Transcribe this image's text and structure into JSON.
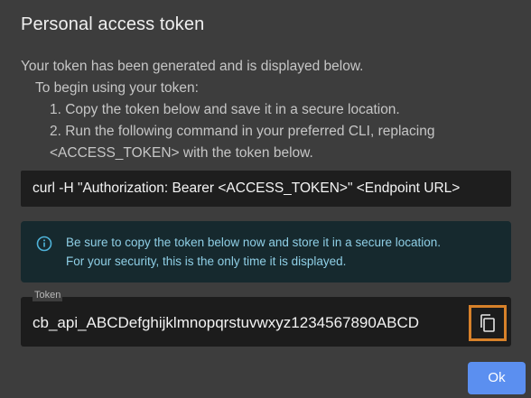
{
  "dialog": {
    "title": "Personal access token",
    "description": {
      "line1": "Your token has been generated and is displayed below.",
      "line2": "To begin using your token:",
      "step1": "1. Copy the token below and save it in a secure location.",
      "step2a": "2. Run the following command in your preferred CLI, replacing",
      "step2b": "<ACCESS_TOKEN> with the token below."
    },
    "command": "curl -H \"Authorization: Bearer <ACCESS_TOKEN>\" <Endpoint URL>",
    "info": {
      "icon": "info-icon",
      "line1": "Be sure to copy the token below now and store it in a secure location.",
      "line2": "For your security, this is the only time it is displayed."
    },
    "token": {
      "label": "Token",
      "value": "cb_api_ABCDefghijklmnopqrstuvwxyz1234567890ABCD",
      "copy_icon": "copy-icon"
    },
    "ok_label": "Ok"
  },
  "colors": {
    "background": "#3d3d3d",
    "accent": "#5b8ff0",
    "highlight": "#d7812a",
    "info_text": "#8fcfe6"
  }
}
